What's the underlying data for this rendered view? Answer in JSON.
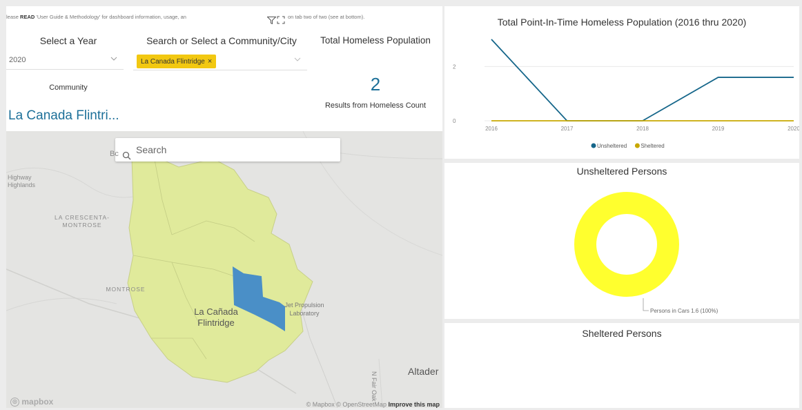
{
  "notice": {
    "prefix": "lease",
    "bold": "READ",
    "text": "'User Guide & Methodology' for dashboard information, usage, an",
    "rest": "on tab two of two (see at bottom)."
  },
  "year_slicer": {
    "title": "Select a Year",
    "value": "2020"
  },
  "community_slicer": {
    "title": "Search or Select a Community/City",
    "selected_tag": "La Canada Flintridge",
    "remove_symbol": "×"
  },
  "total_card": {
    "title": "Total Homeless Population",
    "value": "2",
    "caption": "Results from Homeless Count"
  },
  "community_card": {
    "label": "Community",
    "value": "La Canada Flintri..."
  },
  "map": {
    "search_placeholder": "Search",
    "labels": {
      "highway_highlands": "Highway\nHighlands",
      "la_crescenta": "LA CRESCENTA-\nMONTROSE",
      "montrose": "MONTROSE",
      "city": "La Cañada\nFlintridge",
      "jpl": "Jet Propulsion\nLaboratory",
      "altadena": "Altader",
      "road": "N Fair Oak",
      "partial": "Bc"
    },
    "attribution_plain": "© Mapbox © OpenStreetMap",
    "attribution_bold": "Improve this map",
    "logo": "mapbox",
    "colors": {
      "boundary": "#e0ea9b",
      "highlight": "#4a8fc7"
    }
  },
  "line_panel": {
    "title": "Total Point-In-Time Homeless Population (2016 thru 2020)",
    "legend": [
      {
        "name": "Unsheltered",
        "color": "#15668a"
      },
      {
        "name": "Sheltered",
        "color": "#c8a800"
      }
    ]
  },
  "chart_data": {
    "type": "line",
    "title": "Total Point-In-Time Homeless Population (2016 thru 2020)",
    "x": [
      "2016",
      "2017",
      "2018",
      "2019",
      "2020"
    ],
    "y_ticks": [
      0,
      2
    ],
    "ylim": [
      0,
      3
    ],
    "series": [
      {
        "name": "Unsheltered",
        "values": [
          3,
          0,
          0,
          1.6,
          1.6
        ],
        "color": "#15668a"
      },
      {
        "name": "Sheltered",
        "values": [
          0,
          0,
          0,
          0,
          0
        ],
        "color": "#c8a800"
      }
    ],
    "grid": true,
    "legend_position": "bottom"
  },
  "donut_panel": {
    "title": "Unsheltered Persons",
    "slice_label": "Persons in Cars 1.6 (100%)",
    "slices": [
      {
        "name": "Persons in Cars",
        "value": 1.6,
        "percent": 100,
        "color": "#ffff2e"
      }
    ]
  },
  "sheltered_panel": {
    "title": "Sheltered Persons"
  }
}
